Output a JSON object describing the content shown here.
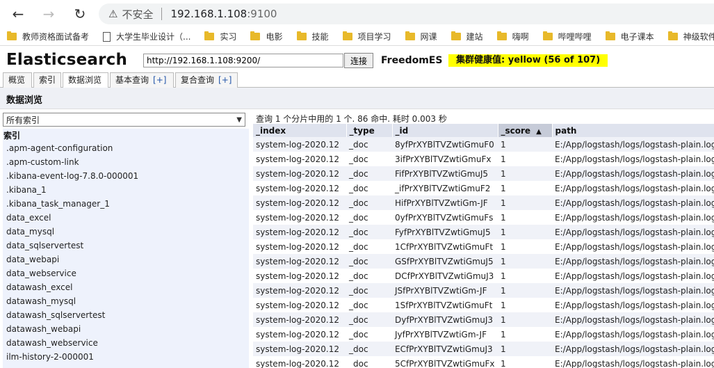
{
  "browser": {
    "back_icon": "arrow-left-icon",
    "forward_icon": "arrow-right-icon",
    "reload_icon": "reload-icon",
    "security_label": "不安全",
    "url_host": "192.168.1.108",
    "url_port": ":9100",
    "bookmarks": [
      {
        "label": "教师资格面试备考",
        "icon": "folder-icon"
      },
      {
        "label": "大学生毕业设计（...",
        "icon": "page-icon"
      },
      {
        "label": "实习",
        "icon": "folder-icon"
      },
      {
        "label": "电影",
        "icon": "folder-icon"
      },
      {
        "label": "技能",
        "icon": "folder-icon"
      },
      {
        "label": "项目学习",
        "icon": "folder-icon"
      },
      {
        "label": "网课",
        "icon": "folder-icon"
      },
      {
        "label": "建站",
        "icon": "folder-icon"
      },
      {
        "label": "嗨啊",
        "icon": "folder-icon"
      },
      {
        "label": "哔哩哔哩",
        "icon": "folder-icon"
      },
      {
        "label": "电子课本",
        "icon": "folder-icon"
      },
      {
        "label": "神级软件",
        "icon": "folder-icon"
      }
    ]
  },
  "app": {
    "title": "Elasticsearch",
    "connect_url": "http://192.168.1.108:9200/",
    "connect_label": "连接",
    "cluster_name": "FreedomES",
    "health_text": "集群健康值: yellow (56 of 107)",
    "health_color": "#ffff00"
  },
  "tabs": [
    {
      "label": "概览",
      "plus": ""
    },
    {
      "label": "索引",
      "plus": ""
    },
    {
      "label": "数据浏览",
      "plus": ""
    },
    {
      "label": "基本查询",
      "plus": "[+]"
    },
    {
      "label": "复合查询",
      "plus": "[+]"
    }
  ],
  "section_title": "数据浏览",
  "left": {
    "select_value": "所有索引",
    "list_header": "索引",
    "indices": [
      ".apm-agent-configuration",
      ".apm-custom-link",
      ".kibana-event-log-7.8.0-000001",
      ".kibana_1",
      ".kibana_task_manager_1",
      "data_excel",
      "data_mysql",
      "data_sqlservertest",
      "data_webapi",
      "data_webservice",
      "datawash_excel",
      "datawash_mysql",
      "datawash_sqlservertest",
      "datawash_webapi",
      "datawash_webservice",
      "ilm-history-2-000001"
    ]
  },
  "results": {
    "summary": "查询 1 个分片中用的 1 个. 86 命中. 耗时 0.003 秒",
    "columns": [
      "_index",
      "_type",
      "_id",
      "_score",
      "path"
    ],
    "sort_arrow": "▲",
    "rows": [
      [
        "system-log-2020.12",
        "_doc",
        "8yfPrXYBlTVZwtiGmuF0",
        "1",
        "E:/App/logstash/logs/logstash-plain.log"
      ],
      [
        "system-log-2020.12",
        "_doc",
        "3ifPrXYBlTVZwtiGmuFx",
        "1",
        "E:/App/logstash/logs/logstash-plain.log"
      ],
      [
        "system-log-2020.12",
        "_doc",
        "FifPrXYBlTVZwtiGmuJ5",
        "1",
        "E:/App/logstash/logs/logstash-plain.log"
      ],
      [
        "system-log-2020.12",
        "_doc",
        "_ifPrXYBlTVZwtiGmuF2",
        "1",
        "E:/App/logstash/logs/logstash-plain.log"
      ],
      [
        "system-log-2020.12",
        "_doc",
        "HifPrXYBlTVZwtiGm-JF",
        "1",
        "E:/App/logstash/logs/logstash-plain.log"
      ],
      [
        "system-log-2020.12",
        "_doc",
        "0yfPrXYBlTVZwtiGmuFs",
        "1",
        "E:/App/logstash/logs/logstash-plain.log"
      ],
      [
        "system-log-2020.12",
        "_doc",
        "FyfPrXYBlTVZwtiGmuJ5",
        "1",
        "E:/App/logstash/logs/logstash-plain.log"
      ],
      [
        "system-log-2020.12",
        "_doc",
        "1CfPrXYBlTVZwtiGmuFt",
        "1",
        "E:/App/logstash/logs/logstash-plain.log"
      ],
      [
        "system-log-2020.12",
        "_doc",
        "GSfPrXYBlTVZwtiGmuJ5",
        "1",
        "E:/App/logstash/logs/logstash-plain.log"
      ],
      [
        "system-log-2020.12",
        "_doc",
        "DCfPrXYBlTVZwtiGmuJ3",
        "1",
        "E:/App/logstash/logs/logstash-plain.log"
      ],
      [
        "system-log-2020.12",
        "_doc",
        "JSfPrXYBlTVZwtiGm-JF",
        "1",
        "E:/App/logstash/logs/logstash-plain.log"
      ],
      [
        "system-log-2020.12",
        "_doc",
        "1SfPrXYBlTVZwtiGmuFt",
        "1",
        "E:/App/logstash/logs/logstash-plain.log"
      ],
      [
        "system-log-2020.12",
        "_doc",
        "DyfPrXYBlTVZwtiGmuJ3",
        "1",
        "E:/App/logstash/logs/logstash-plain.log"
      ],
      [
        "system-log-2020.12",
        "_doc",
        "JyfPrXYBlTVZwtiGm-JF",
        "1",
        "E:/App/logstash/logs/logstash-plain.log"
      ],
      [
        "system-log-2020.12",
        "_doc",
        "ECfPrXYBlTVZwtiGmuJ3",
        "1",
        "E:/App/logstash/logs/logstash-plain.log"
      ],
      [
        "system-log-2020.12",
        "_doc",
        "5CfPrXYBlTVZwtiGmuFx",
        "1",
        "E:/App/logstash/logs/logstash-plain.log"
      ]
    ]
  }
}
